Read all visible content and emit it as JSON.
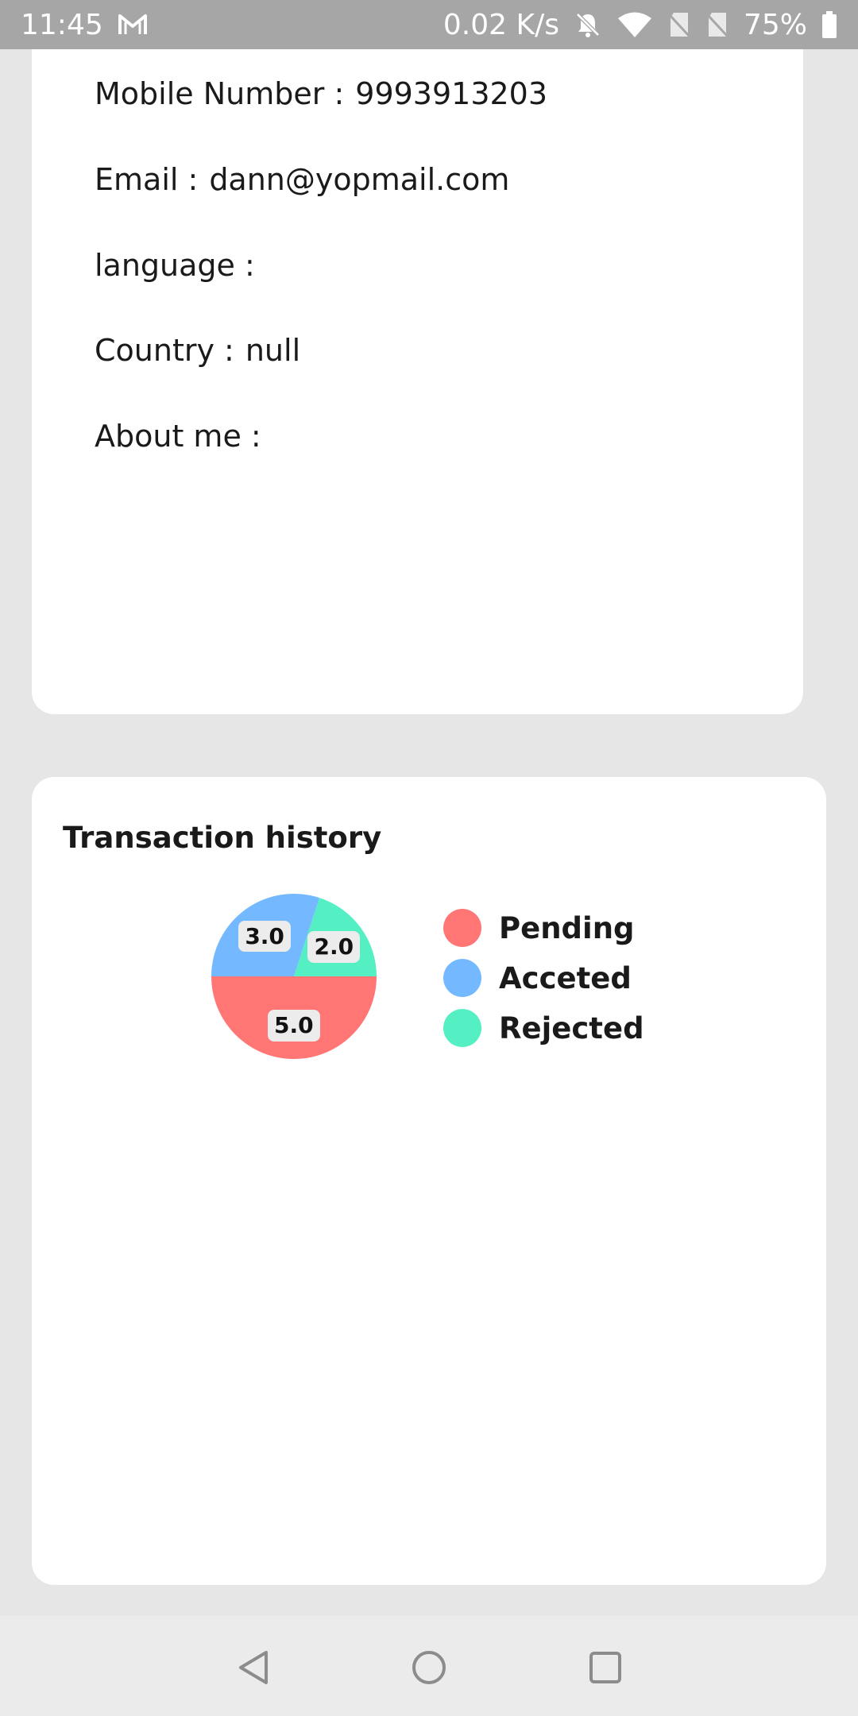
{
  "status_bar": {
    "time": "11:45",
    "network_speed": "0.02 K/s",
    "battery": "75%",
    "icons": [
      "gmail-icon",
      "bell-muted-icon",
      "wifi-icon",
      "no-sim-icon",
      "no-sim-icon",
      "battery-icon"
    ]
  },
  "profile": {
    "mobile_label": "Mobile Number :",
    "mobile_value": "9993913203",
    "email_label": "Email :",
    "email_value": "dann@yopmail.com",
    "language_label": "language :",
    "language_value": "",
    "country_label": "Country :",
    "country_value": "null",
    "about_label": "About me :",
    "about_value": ""
  },
  "transactions": {
    "title": "Transaction history",
    "legend": [
      {
        "label": "Pending",
        "color": "#ff7675"
      },
      {
        "label": "Acceted",
        "color": "#74b9ff"
      },
      {
        "label": "Rejected",
        "color": "#55efc4"
      }
    ]
  },
  "chart_data": {
    "type": "pie",
    "title": "Transaction history",
    "slices": [
      {
        "label": "Pending",
        "value": 5.0,
        "display": "5.0",
        "color": "#ff7675"
      },
      {
        "label": "Acceted",
        "value": 3.0,
        "display": "3.0",
        "color": "#74b9ff"
      },
      {
        "label": "Rejected",
        "value": 2.0,
        "display": "2.0",
        "color": "#55efc4"
      }
    ],
    "legend_position": "right"
  },
  "nav_bar": {
    "icons": [
      "back-icon",
      "home-icon",
      "recents-icon"
    ]
  }
}
